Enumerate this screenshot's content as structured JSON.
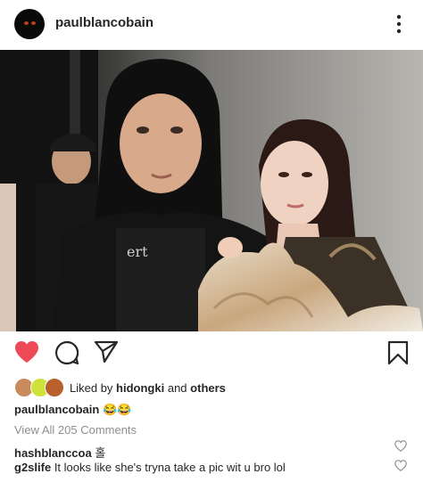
{
  "post": {
    "username": "paulblancobain"
  },
  "icons": {
    "more": "more-vertical-icon",
    "like": "heart-filled-icon",
    "comment": "comment-bubble-icon",
    "share": "paper-plane-icon",
    "save": "bookmark-icon"
  },
  "likes": {
    "prefix": "Liked by",
    "user": "hidongki",
    "joiner": "and",
    "others": "others"
  },
  "caption": {
    "username": "paulblancobain",
    "text": "😂😂"
  },
  "view_all_comments": "View All 205 Comments",
  "comments": [
    {
      "username": "hashblanccoa",
      "text": "홀"
    },
    {
      "username": "g2slife",
      "text": "It looks like she's tryna take a pic wit u bro lol"
    }
  ],
  "colors": {
    "like_red": "#ed4956",
    "text": "#262626",
    "muted": "#8e8e8e"
  }
}
